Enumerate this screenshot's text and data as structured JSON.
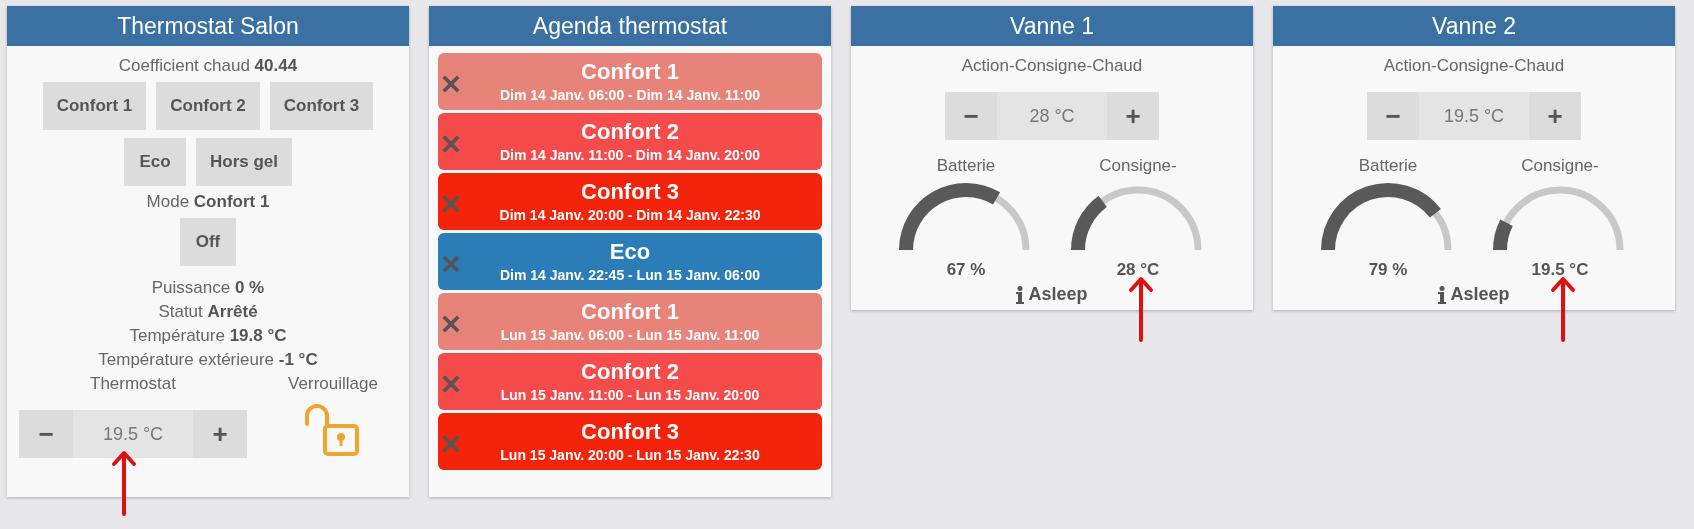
{
  "cards": [
    {
      "kind": "thermostat",
      "title": "Thermostat Salon",
      "coefficient": {
        "label": "Coefficient chaud",
        "value": "40.44"
      },
      "mode_button_rows": [
        [
          "Confort 1",
          "Confort 2",
          "Confort 3"
        ],
        [
          "Eco",
          "Hors gel"
        ]
      ],
      "mode": {
        "label": "Mode",
        "value": "Confort 1"
      },
      "off_button": "Off",
      "info": [
        {
          "label": "Puissance",
          "value": "0 %"
        },
        {
          "label": "Statut",
          "value": "Arrêté"
        },
        {
          "label": "Température",
          "value": "19.8 °C"
        },
        {
          "label": "Température extérieure",
          "value": "-1 °C"
        }
      ],
      "thermostat": {
        "label": "Thermostat",
        "minus": "−",
        "value": "19.5 °C",
        "plus": "+",
        "annotated": true
      },
      "lock": {
        "label": "Verrouillage",
        "locked": false
      }
    },
    {
      "kind": "agenda",
      "title": "Agenda thermostat",
      "items": [
        {
          "title": "Confort 1",
          "period": "Dim 14 Janv. 06:00 - Dim 14 Janv. 11:00",
          "color": "#e8837a"
        },
        {
          "title": "Confort 2",
          "period": "Dim 14 Janv. 11:00 - Dim 14 Janv. 20:00",
          "color": "#f64b4b"
        },
        {
          "title": "Confort 3",
          "period": "Dim 14 Janv. 20:00 - Dim 14 Janv. 22:30",
          "color": "#f4230b"
        },
        {
          "title": "Eco",
          "period": "Dim 14 Janv. 22:45 - Lun 15 Janv. 06:00",
          "color": "#2b7db8"
        },
        {
          "title": "Confort 1",
          "period": "Lun 15 Janv. 06:00 - Lun 15 Janv. 11:00",
          "color": "#e8837a"
        },
        {
          "title": "Confort 2",
          "period": "Lun 15 Janv. 11:00 - Lun 15 Janv. 20:00",
          "color": "#f64b4b"
        },
        {
          "title": "Confort 3",
          "period": "Lun 15 Janv. 20:00 - Lun 15 Janv. 22:30",
          "color": "#f4230b"
        }
      ]
    },
    {
      "kind": "valve",
      "title": "Vanne 1",
      "action_label": "Action-Consigne-Chaud",
      "stepper": {
        "minus": "−",
        "value": "28 °C",
        "plus": "+"
      },
      "gauges": [
        {
          "label": "Batterie",
          "reading": "67 %",
          "annotated": false
        },
        {
          "label": "Consigne-",
          "reading": "28 °C",
          "annotated": true
        }
      ],
      "status": "Asleep"
    },
    {
      "kind": "valve",
      "title": "Vanne 2",
      "action_label": "Action-Consigne-Chaud",
      "stepper": {
        "minus": "−",
        "value": "19.5 °C",
        "plus": "+"
      },
      "gauges": [
        {
          "label": "Batterie",
          "reading": "79 %",
          "annotated": false
        },
        {
          "label": "Consigne-",
          "reading": "19.5 °C",
          "annotated": true
        }
      ],
      "status": "Asleep"
    }
  ]
}
